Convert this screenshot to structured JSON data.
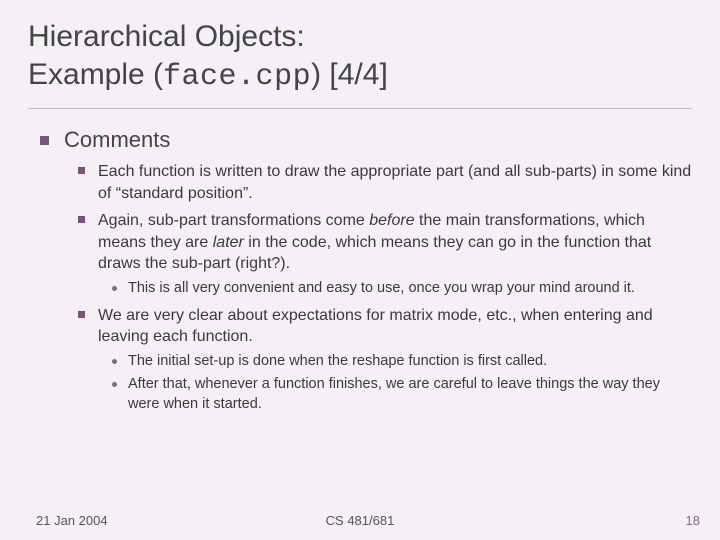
{
  "title": {
    "line1": "Hierarchical Objects:",
    "line2_pre": "Example (",
    "line2_code": "face.cpp",
    "line2_post": ")  [4/4]"
  },
  "content": {
    "heading": "Comments",
    "points": [
      {
        "text": "Each function is written to draw the appropriate part (and all sub-parts) in some kind of “standard position”."
      },
      {
        "text_parts": [
          "Again, sub-part transformations come ",
          "before",
          " the main transformations, which means they are ",
          "later",
          " in the code, which means they can go in the function that draws the sub-part (right?)."
        ],
        "subpoints": [
          "This is all very convenient and easy to use, once you wrap your mind around it."
        ]
      },
      {
        "text": "We are very clear about expectations for matrix mode, etc., when entering and leaving each function.",
        "subpoints": [
          "The initial set-up is done when the reshape function is first called.",
          "After that, whenever a function finishes, we are careful to leave things the way they were when it started."
        ]
      }
    ]
  },
  "footer": {
    "date": "21 Jan 2004",
    "course": "CS 481/681",
    "page": "18"
  }
}
